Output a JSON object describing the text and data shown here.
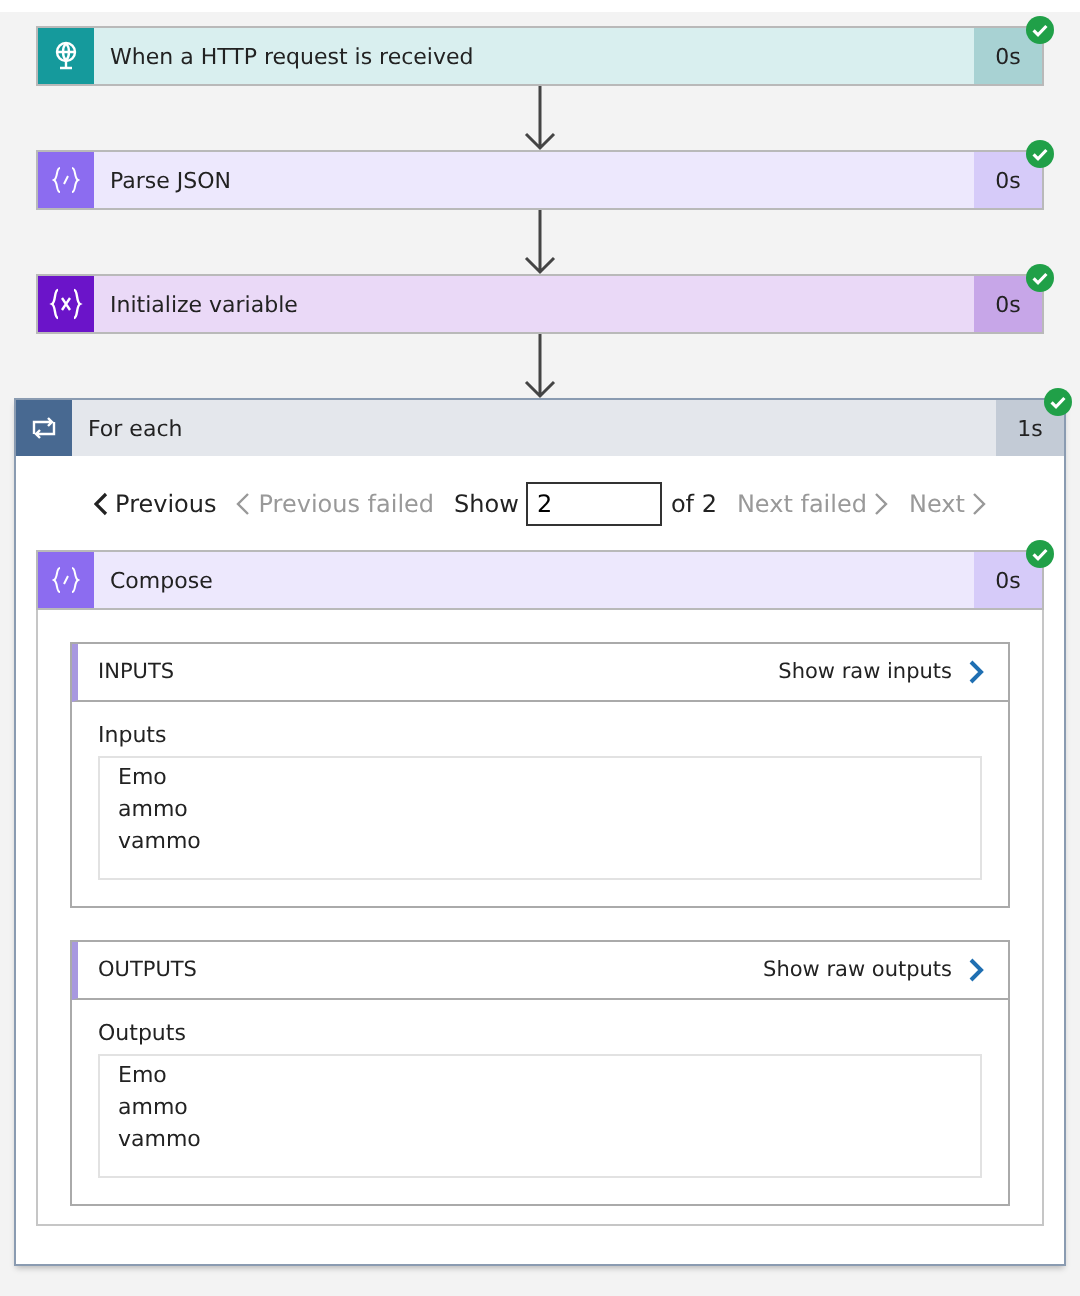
{
  "steps": [
    {
      "kind": "http",
      "title": "When a HTTP request is received",
      "duration": "0s",
      "succeeded": true
    },
    {
      "kind": "parse",
      "title": "Parse JSON",
      "duration": "0s",
      "succeeded": true
    },
    {
      "kind": "variable",
      "title": "Initialize variable",
      "duration": "0s",
      "succeeded": true
    }
  ],
  "for_each": {
    "title": "For each",
    "duration": "1s",
    "succeeded": true,
    "pager": {
      "previous": {
        "label": "Previous",
        "disabled": false
      },
      "previous_failed": {
        "label": "Previous failed",
        "disabled": true
      },
      "show_label": "Show",
      "show_value": "2",
      "of_label": "of 2",
      "next_failed": {
        "label": "Next failed",
        "disabled": true
      },
      "next": {
        "label": "Next",
        "disabled": true
      }
    },
    "action": {
      "kind": "parse",
      "title": "Compose",
      "duration": "0s",
      "succeeded": true,
      "sections": [
        {
          "heading": "INPUTS",
          "raw_link": "Show raw inputs",
          "field_label": "Inputs",
          "lines": [
            "Emo",
            "ammo",
            "vammo"
          ]
        },
        {
          "heading": "OUTPUTS",
          "raw_link": "Show raw outputs",
          "field_label": "Outputs",
          "lines": [
            "Emo",
            "ammo",
            "vammo"
          ]
        }
      ]
    }
  }
}
